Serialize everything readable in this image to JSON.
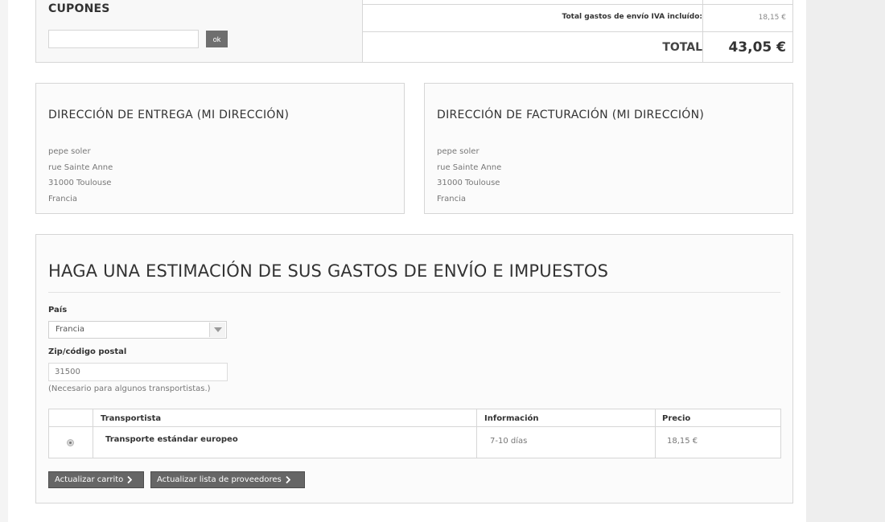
{
  "coupons": {
    "title": "CUPONES",
    "input_value": "",
    "ok_label": "ok"
  },
  "totals": {
    "shipping_label": "Total gastos de envío IVA incluído:",
    "shipping_value": "18,15 €",
    "total_label": "TOTAL",
    "total_value": "43,05 €"
  },
  "delivery_address": {
    "title": "DIRECCIÓN DE ENTREGA (MI DIRECCIÓN)",
    "lines": [
      "pepe soler",
      "rue Sainte Anne",
      "31000 Toulouse",
      "Francia"
    ]
  },
  "invoice_address": {
    "title": "DIRECCIÓN DE FACTURACIÓN (MI DIRECCIÓN)",
    "lines": [
      "pepe soler",
      "rue Sainte Anne",
      "31000 Toulouse",
      "Francia"
    ]
  },
  "estimate": {
    "title": "HAGA UNA ESTIMACIÓN DE SUS GASTOS DE ENVÍO E IMPUESTOS",
    "country_label": "País",
    "country_value": "Francia",
    "zip_label": "Zip/código postal",
    "zip_placeholder": "31500",
    "zip_note": "(Necesario para algunos transportistas.)",
    "table": {
      "headers": [
        "Transportista",
        "Información",
        "Precio"
      ],
      "rows": [
        {
          "carrier": "Transporte estándar europeo",
          "info": "7-10 días",
          "price": "18,15 €"
        }
      ]
    },
    "buttons": {
      "update_cart": "Actualizar carrito",
      "update_carriers": "Actualizar lista de proveedores"
    }
  },
  "icons": {
    "select_arrow": "chevron-down-icon",
    "button_arrow": "chevron-right-icon",
    "radio": "radio-icon"
  }
}
